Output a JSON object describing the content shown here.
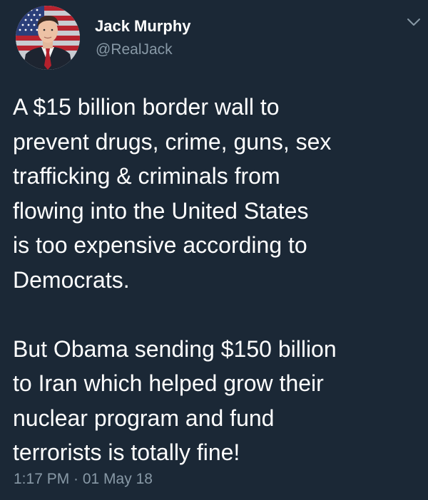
{
  "tweet": {
    "author": {
      "display_name": "Jack Murphy",
      "handle": "@RealJack",
      "avatar_icon": "profile-photo-flag-background"
    },
    "menu_icon": "chevron-down-icon",
    "paragraphs": [
      [
        "A $15 billion border wall to",
        "prevent drugs, crime, guns, sex",
        "trafficking & criminals from",
        "flowing into the United States",
        "is too expensive according to",
        "Democrats."
      ],
      [
        "But Obama sending $150 billion",
        "to Iran which helped grow their",
        "nuclear program and fund",
        "terrorists is totally fine!"
      ]
    ],
    "timestamp": "1:17 PM · 01 May 18"
  },
  "colors": {
    "background": "#1b2836",
    "text": "#ffffff",
    "secondary_text": "#8899a6"
  }
}
